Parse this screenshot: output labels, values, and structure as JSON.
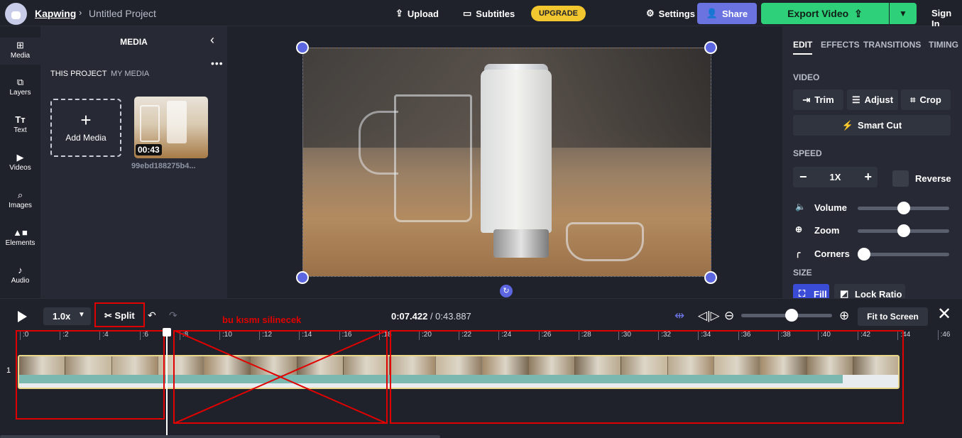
{
  "header": {
    "brand": "Kapwing",
    "separator": "›",
    "project_title": "Untitled Project",
    "upload_label": "Upload",
    "subtitles_label": "Subtitles",
    "upgrade_label": "UPGRADE",
    "settings_label": "Settings",
    "share_label": "Share",
    "export_label": "Export Video",
    "signin_label": "Sign In"
  },
  "rail": {
    "items": [
      {
        "label": "Media",
        "icon": "plus-square-icon"
      },
      {
        "label": "Layers",
        "icon": "layers-icon"
      },
      {
        "label": "Text",
        "icon": "text-icon"
      },
      {
        "label": "Videos",
        "icon": "video-icon"
      },
      {
        "label": "Images",
        "icon": "search-icon"
      },
      {
        "label": "Elements",
        "icon": "shapes-icon"
      },
      {
        "label": "Audio",
        "icon": "music-note-icon"
      }
    ]
  },
  "media": {
    "title": "MEDIA",
    "tab_this_project": "THIS PROJECT",
    "tab_my_media": "MY MEDIA",
    "add_media_label": "Add Media",
    "thumb_duration": "00:43",
    "thumb_name": "99ebd188275b4..."
  },
  "right_panel": {
    "tabs": [
      "EDIT",
      "EFFECTS",
      "TRANSITIONS",
      "TIMING"
    ],
    "video_section": "VIDEO",
    "trim_label": "Trim",
    "adjust_label": "Adjust",
    "crop_label": "Crop",
    "smart_cut_label": "Smart Cut",
    "speed_section": "SPEED",
    "speed_value": "1X",
    "reverse_label": "Reverse",
    "volume_label": "Volume",
    "volume_level": 0.5,
    "zoom_label": "Zoom",
    "zoom_level": 0.5,
    "corners_label": "Corners",
    "corners_level": 0.0,
    "size_section": "SIZE",
    "fill_label": "Fill",
    "lock_ratio_label": "Lock Ratio"
  },
  "timeline": {
    "speed_value": "1.0x",
    "split_label": "Split",
    "annotation": "bu kısmı silinecek",
    "current_time": "0:07.422",
    "total_time": "/ 0:43.887",
    "fit_label": "Fit to Screen",
    "track_number": "1",
    "zoom_level": 0.55,
    "ruler": [
      ":0",
      ":2",
      ":4",
      ":6",
      ":8",
      ":10",
      ":12",
      ":14",
      ":16",
      ":18",
      ":20",
      ":22",
      ":24",
      ":26",
      ":28",
      ":30",
      ":32",
      ":34",
      ":36",
      ":38",
      ":40",
      ":42",
      ":44",
      ":46"
    ]
  },
  "colors": {
    "accent": "#5b66e0",
    "export_green": "#2ed079",
    "upgrade_yellow": "#f2c62f",
    "annotation_red": "#e00000"
  }
}
